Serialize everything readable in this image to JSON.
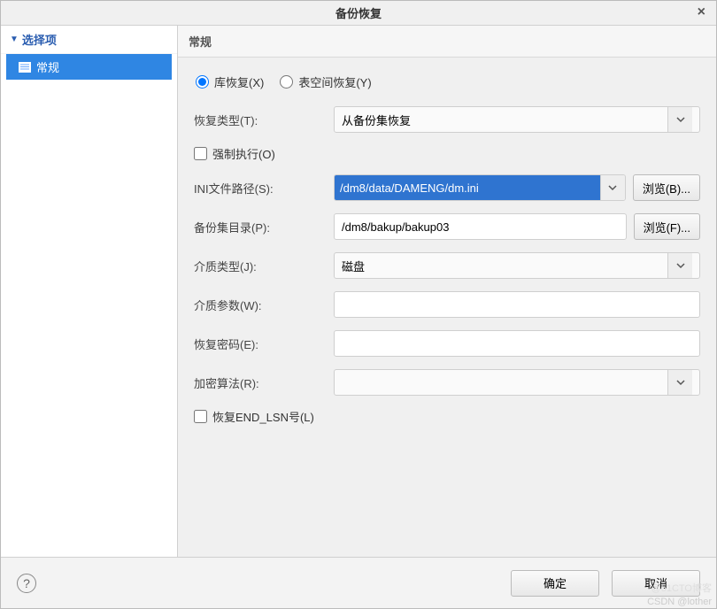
{
  "dialog": {
    "title": "备份恢复",
    "close_glyph": "×"
  },
  "sidebar": {
    "header": "选择项",
    "items": [
      {
        "label": "常规",
        "selected": true
      }
    ]
  },
  "content": {
    "header": "常规",
    "radios": {
      "db_restore": "库恢复(X)",
      "tablespace_restore": "表空间恢复(Y)"
    },
    "restore_type": {
      "label": "恢复类型(T):",
      "value": "从备份集恢复"
    },
    "force_execute": "强制执行(O)",
    "ini_path": {
      "label": "INI文件路径(S):",
      "value": "/dm8/data/DAMENG/dm.ini",
      "browse": "浏览(B)..."
    },
    "backup_dir": {
      "label": "备份集目录(P):",
      "value": "/dm8/bakup/bakup03",
      "browse": "浏览(F)..."
    },
    "media_type": {
      "label": "介质类型(J):",
      "value": "磁盘"
    },
    "media_params": {
      "label": "介质参数(W):",
      "value": ""
    },
    "restore_password": {
      "label": "恢复密码(E):",
      "value": ""
    },
    "encrypt_algo": {
      "label": "加密算法(R):",
      "value": ""
    },
    "restore_end_lsn": "恢复END_LSN号(L)"
  },
  "footer": {
    "ok": "确定",
    "cancel": "取消"
  },
  "watermark": {
    "line1": "@51CTO博客",
    "line2": "CSDN @lother"
  }
}
